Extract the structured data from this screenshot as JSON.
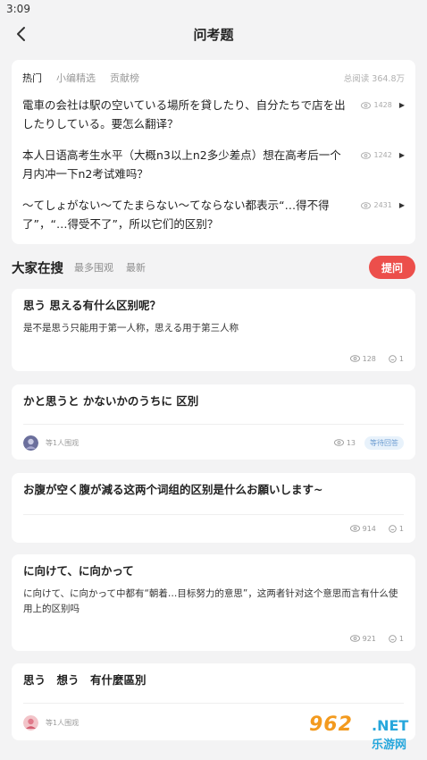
{
  "status_bar": {
    "time": "3:09"
  },
  "header": {
    "title": "问考题"
  },
  "hot": {
    "tabs": [
      "热门",
      "小编精选",
      "贡献榜"
    ],
    "total_reads": "总阅读 364.8万",
    "items": [
      {
        "text": "電車の会社は駅の空いている場所を貸したり、自分たちで店を出したりしている。要怎么翻译？",
        "views": "1428"
      },
      {
        "text": "本人日语高考生水平（大概n3以上n2多少差点）想在高考后一个月内冲一下n2考试难吗？",
        "views": "1242"
      },
      {
        "text": "〜てしょがない〜てたまらない〜てならない都表示“…得不得了”，“…得受不了”，所以它们的区别？",
        "views": "2431"
      }
    ]
  },
  "section": {
    "title": "大家在搜",
    "tabs": [
      "最多围观",
      "最新"
    ],
    "ask_label": "提问"
  },
  "questions": [
    {
      "title": "思う 思える有什么区别呢？",
      "desc": "是不是思う只能用于第一人称，思える用于第三人称",
      "views": "128",
      "comments": "1"
    },
    {
      "title": "かと思うと かないかのうちに 区別",
      "watchers": "等1人围观",
      "views": "13",
      "badge": "等待回答"
    },
    {
      "title": "お腹が空く腹が減る这两个词组的区别是什么お願いします~",
      "views": "914",
      "comments": "1"
    },
    {
      "title": "に向けて、に向かって",
      "desc": "に向けて、に向かって中都有“朝着…目标努力的意思”，这两者针对这个意思而言有什么使用上的区别吗",
      "views": "921",
      "comments": "1"
    },
    {
      "title": "思う　想う　有什麼區別",
      "watchers": "等1人围观"
    }
  ],
  "watermark": {
    "brand": "962",
    "suffix": ".NET",
    "sub": "乐游网"
  },
  "colors": {
    "accent": "#ec4f4b",
    "badge_text": "#6a9bd0",
    "badge_bg": "#e8f2fb"
  }
}
